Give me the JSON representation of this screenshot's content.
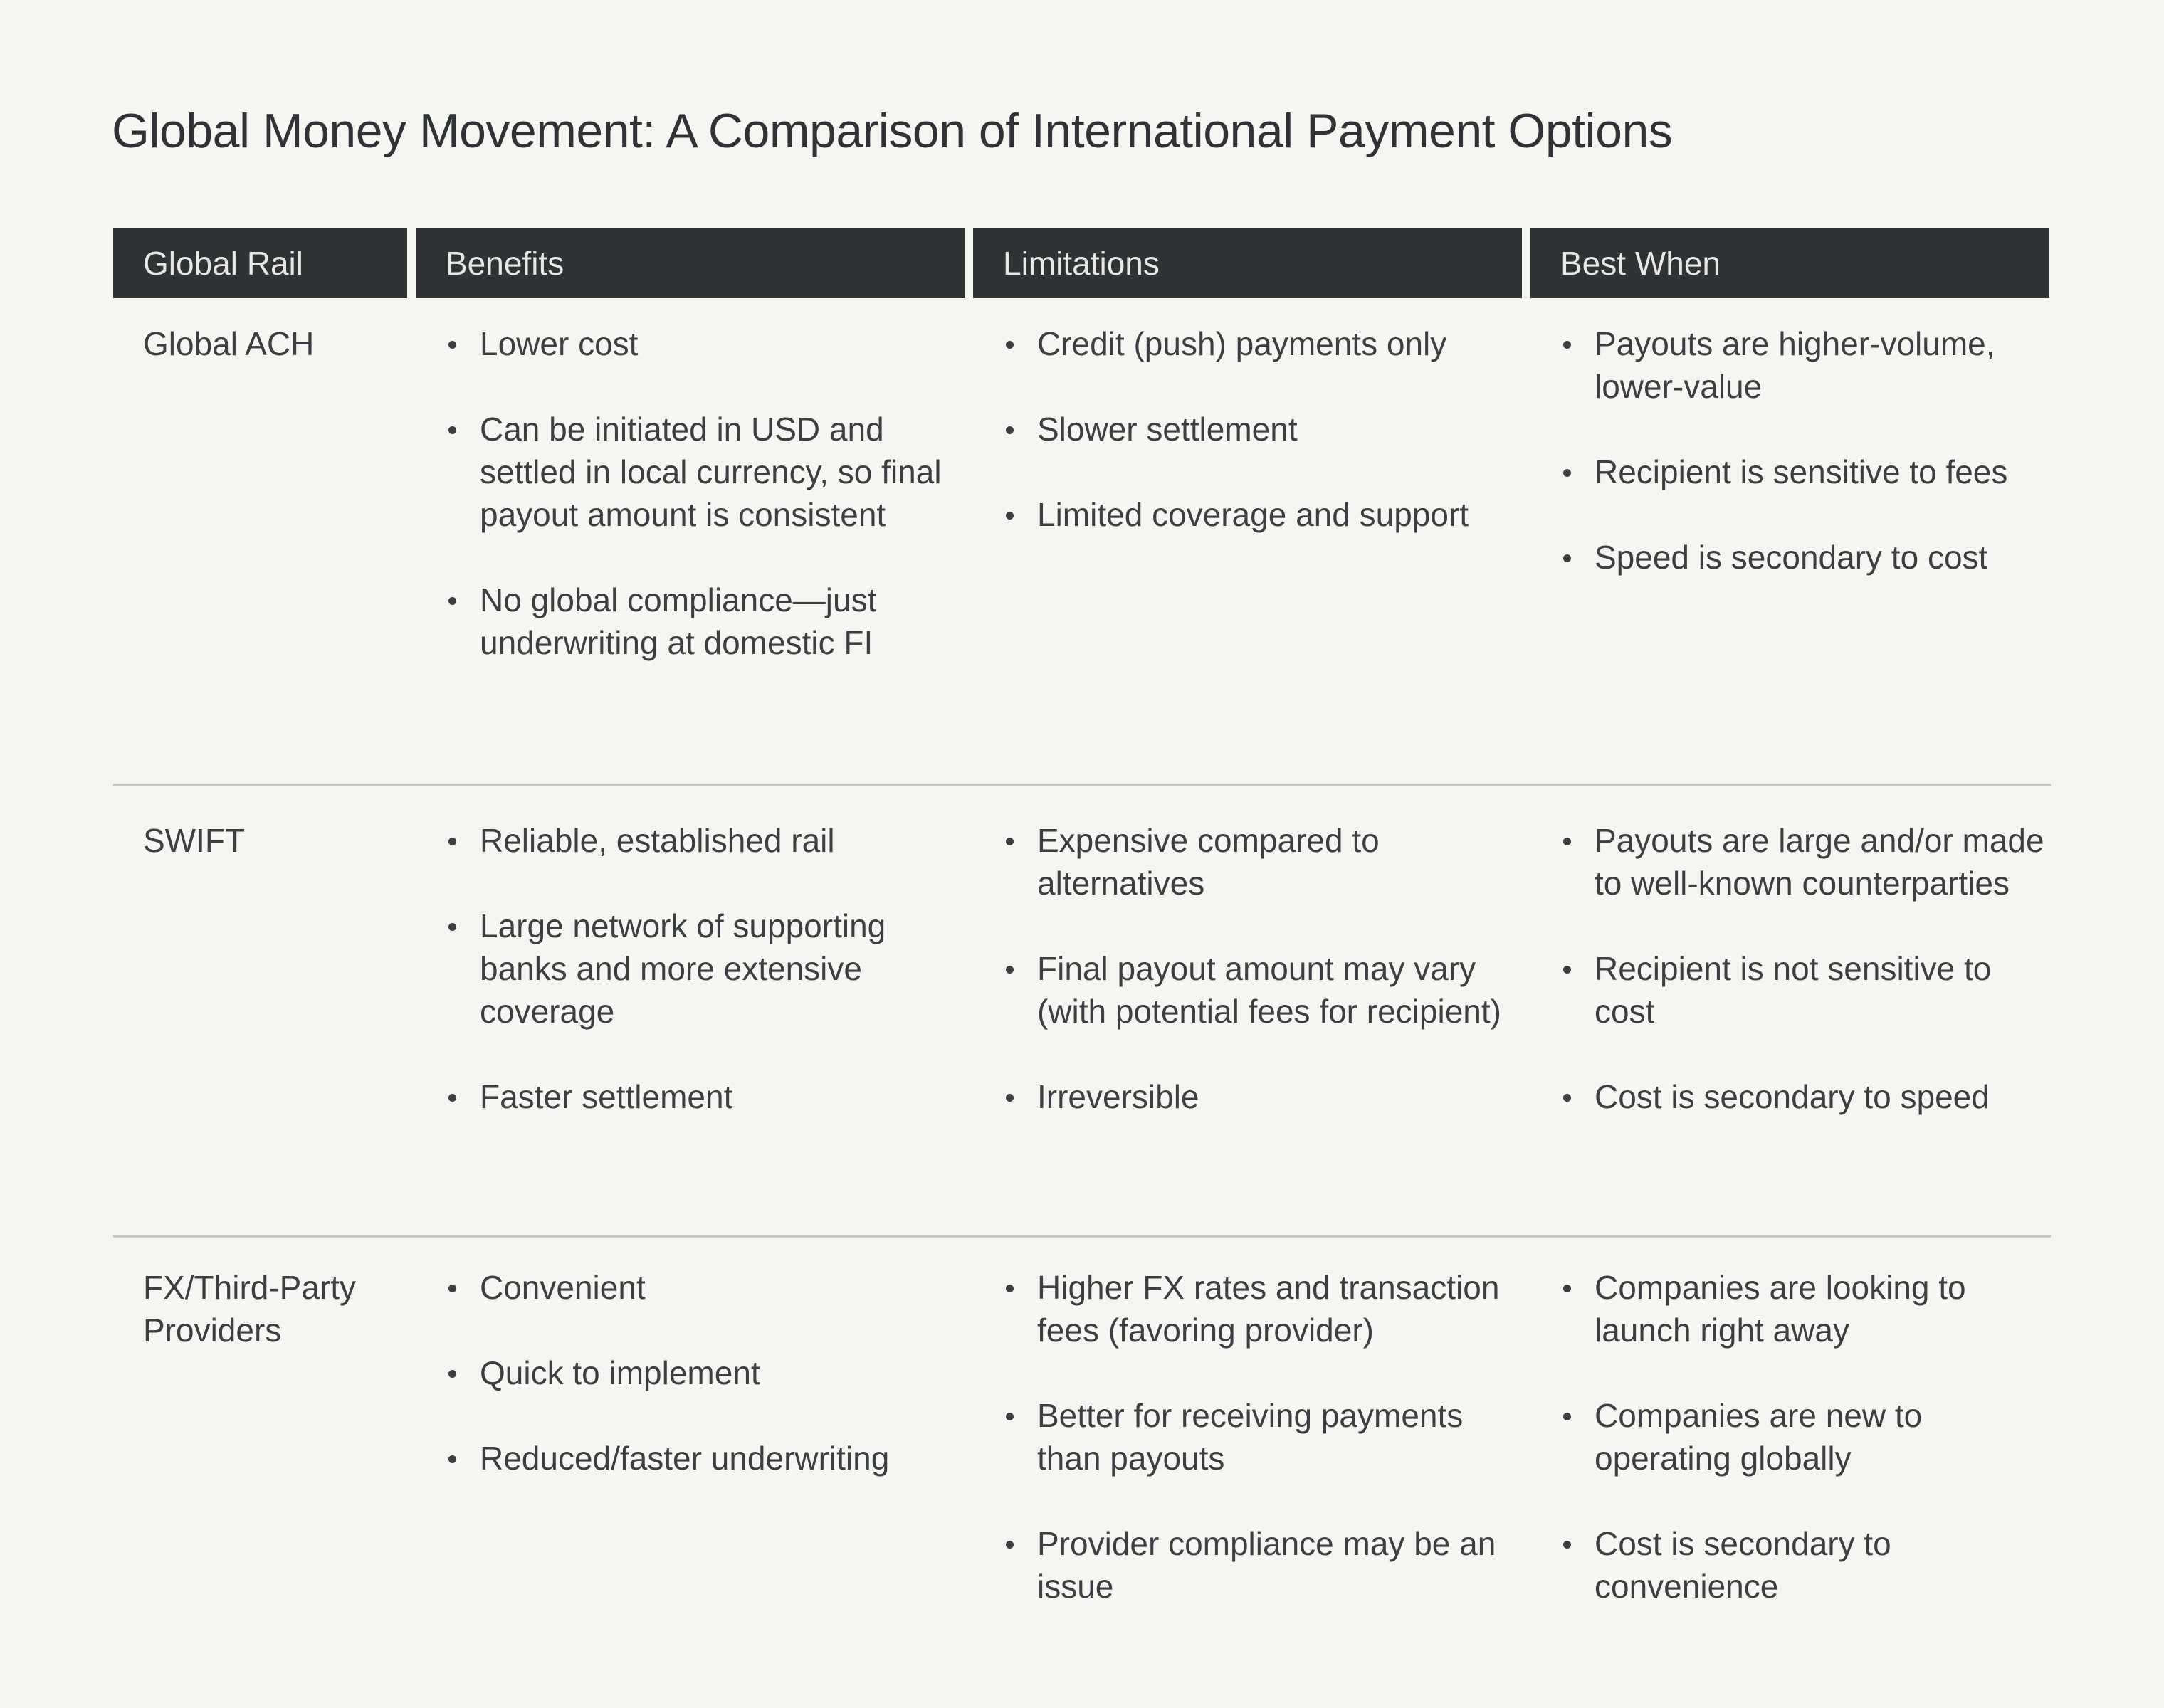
{
  "title": "Global Money Movement: A Comparison of International Payment Options",
  "table": {
    "headers": [
      "Global Rail",
      "Benefits",
      "Limitations",
      "Best When"
    ],
    "rows": [
      {
        "rail": "Global ACH",
        "benefits": [
          "Lower cost",
          "Can be initiated in USD and settled in local currency, so final payout amount is consistent",
          "No global compliance—just underwriting at domestic FI"
        ],
        "limitations": [
          "Credit (push) payments only",
          "Slower settlement",
          "Limited coverage and support"
        ],
        "best_when": [
          "Payouts are higher-volume, lower-value",
          "Recipient is sensitive to fees",
          "Speed is secondary to cost"
        ]
      },
      {
        "rail": "SWIFT",
        "benefits": [
          "Reliable, established rail",
          "Large network of supporting banks and more extensive coverage",
          "Faster settlement"
        ],
        "limitations": [
          "Expensive compared to alternatives",
          "Final payout amount may vary (with potential fees for recipient)",
          "Irreversible"
        ],
        "best_when": [
          "Payouts are large and/or made to well-known counterparties",
          "Recipient is not sensitive to cost",
          "Cost is secondary to speed"
        ]
      },
      {
        "rail": "FX/Third-Party Providers",
        "benefits": [
          "Convenient",
          "Quick to implement",
          "Reduced/faster underwriting"
        ],
        "limitations": [
          "Higher FX rates and transaction fees (favoring provider)",
          "Better for receiving payments than payouts",
          "Provider compliance may be an issue"
        ],
        "best_when": [
          "Companies are looking to launch right away",
          "Companies are new to operating globally",
          "Cost is secondary to convenience"
        ]
      }
    ]
  }
}
